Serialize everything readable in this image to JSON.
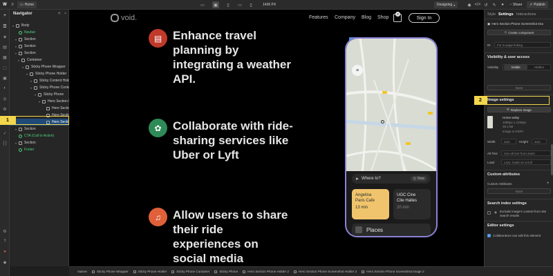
{
  "topbar": {
    "home_label": "Home",
    "viewport_width": "1436 PX",
    "mode_label": "Designing",
    "share_label": "Share",
    "publish_label": "Publish"
  },
  "navigator": {
    "title": "Navigator",
    "items": [
      {
        "label": "Body",
        "kind": "element"
      },
      {
        "label": "Navbar",
        "kind": "symbol"
      },
      {
        "label": "Section",
        "kind": "element"
      },
      {
        "label": "Section",
        "kind": "element"
      },
      {
        "label": "Section",
        "kind": "element"
      },
      {
        "label": "Container",
        "kind": "element"
      },
      {
        "label": "Sticky Phone Wrapper",
        "kind": "element"
      },
      {
        "label": "Sticky Phone Holder",
        "kind": "element"
      },
      {
        "label": "Sticky Content Holder",
        "kind": "element"
      },
      {
        "label": "Sticky Phone Container",
        "kind": "element"
      },
      {
        "label": "Sticky Phone",
        "kind": "element"
      },
      {
        "label": "Hero Section Phone",
        "kind": "element"
      },
      {
        "label": "Hero Section",
        "kind": "element"
      },
      {
        "label": "Hero Section",
        "kind": "element"
      },
      {
        "label": "Hero Section",
        "kind": "element",
        "selected": true
      },
      {
        "label": "Section",
        "kind": "element"
      },
      {
        "label": "CTA (Call to Action)",
        "kind": "symbol"
      },
      {
        "label": "Section",
        "kind": "element"
      },
      {
        "label": "Footer",
        "kind": "symbol"
      }
    ]
  },
  "site": {
    "logo": "void.",
    "nav": [
      "Features",
      "Company",
      "Blog",
      "Shop"
    ],
    "cart_count": "0",
    "signin_label": "Sign In",
    "features": [
      {
        "text": "Enhance travel planning by integrating a weather API.",
        "icon": "film-icon",
        "color": "#c0392b"
      },
      {
        "text": "Collaborate with ride-sharing services like Uber or Lyft",
        "icon": "leaf-icon",
        "color": "#2e8b57"
      },
      {
        "text": "Allow users to share their ride experiences on social media platforms",
        "icon": "music-icon",
        "color": "#e0603a"
      }
    ],
    "selection_label": "Hero Section Phone Screenshot Image 2"
  },
  "phone": {
    "where_to": "Where to?",
    "now_label": "Now",
    "card1_title": "Angelina Paris Cafe",
    "card1_time": "13 min",
    "card2_title": "UGC Cine Cite Halles",
    "card2_time": "20 min",
    "places_label": "Places"
  },
  "rpanel": {
    "tabs": [
      "Style",
      "Settings",
      "Interactions"
    ],
    "element_name": "Hero Section Phone Screenshot Ima",
    "create_component": "Create component",
    "id_label": "ID",
    "id_placeholder": "For in-page linking",
    "visibility_title": "Visibility & user access",
    "visibility_label": "Visibility",
    "visible_label": "Visible",
    "hidden_label": "Hidden",
    "none_label": "None",
    "image_settings_title": "Image settings",
    "replace_image": "Replace image",
    "image_name": "Home webp",
    "image_dims": "1080px x 2190px",
    "image_size": "39.4 kB",
    "image_hidpi": "Image is HiDPI",
    "width_label": "Width",
    "height_label": "Height",
    "auto": "auto",
    "alt_label": "Alt Text",
    "alt_value": "Use alt text from asset",
    "load_label": "Load",
    "load_value": "Lazy: loads on scroll",
    "custom_attrs_title": "Custom attributes",
    "custom_attrs_label": "Custom Attributes",
    "search_title": "Search index settings",
    "search_text": "Exclude image's content from site search results",
    "editor_title": "Editor settings",
    "editor_text": "Collaborators can edit this element"
  },
  "breadcrumbs": [
    "Sticky Phone Wrapper",
    "Sticky Phone Holder",
    "Sticky Phone Container",
    "Sticky Phone",
    "Hero Section Phone Holder 2",
    "Hero Section Phone Screenshot Holder 2",
    "Hero Section Phone Screenshot Image 2"
  ],
  "breadcrumb_prefix": "ntainer",
  "markers": [
    "1",
    "2"
  ],
  "colors": {
    "accent": "#4a90e2",
    "selection": "#1f4a78",
    "symbol": "#4fd17c",
    "marker": "#f3d64c",
    "phone_frame": "#8b82d6"
  }
}
